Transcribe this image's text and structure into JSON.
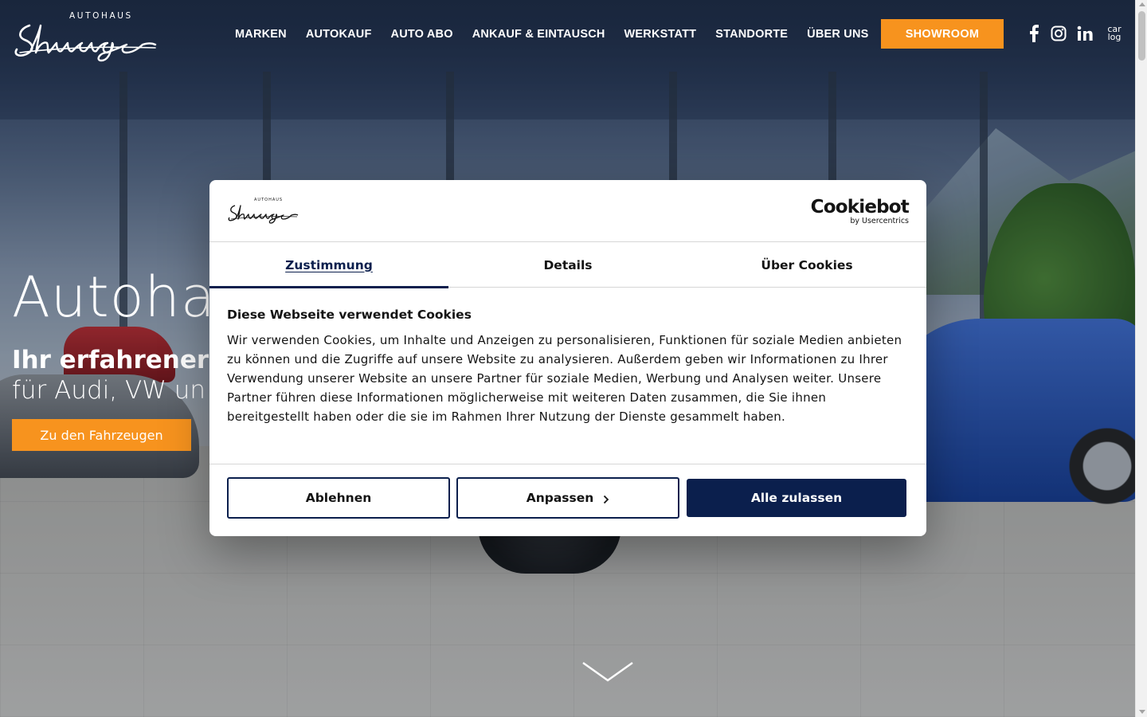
{
  "header": {
    "logo_small": "AUTOHAUS",
    "logo_script": "Schwaiger",
    "nav": [
      "MARKEN",
      "AUTOKAUF",
      "AUTO ABO",
      "ANKAUF & EINTAUSCH",
      "WERKSTATT",
      "STANDORTE",
      "ÜBER UNS"
    ],
    "showroom_label": "SHOWROOM",
    "social_icons": [
      "facebook-icon",
      "instagram-icon",
      "linkedin-icon",
      "carclog-icon"
    ],
    "carclog_text_top": "car",
    "carclog_text_bottom": "log"
  },
  "hero": {
    "title": "Autoha",
    "subtitle_bold": "Ihr erfahrener S",
    "subtitle_light": "für Audi, VW un",
    "cta_label": "Zu den Fahrzeugen"
  },
  "cookie_dialog": {
    "cookiebot_main": "Cookiebot",
    "cookiebot_by": "by Usercentrics",
    "tabs": [
      "Zustimmung",
      "Details",
      "Über Cookies"
    ],
    "active_tab": "Zustimmung",
    "heading": "Diese Webseite verwendet Cookies",
    "body": "Wir verwenden Cookies, um Inhalte und Anzeigen zu personalisieren, Funktionen für soziale Medien anbieten zu können und die Zugriffe auf unsere Website zu analysieren. Außerdem geben wir Informationen zu Ihrer Verwendung unserer Website an unsere Partner für soziale Medien, Werbung und Analysen weiter. Unsere Partner führen diese Informationen möglicherweise mit weiteren Daten zusammen, die Sie ihnen bereitgestellt haben oder die sie im Rahmen Ihrer Nutzung der Dienste gesammelt haben.",
    "buttons": {
      "decline": "Ablehnen",
      "customize": "Anpassen",
      "allow_all": "Alle zulassen"
    }
  },
  "colors": {
    "accent_orange": "#f7931e",
    "navy": "#0b1f4d",
    "text": "#141414"
  }
}
